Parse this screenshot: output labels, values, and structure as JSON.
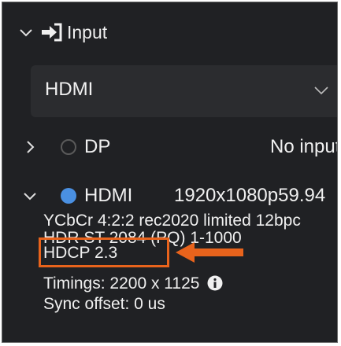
{
  "section": {
    "title": "Input"
  },
  "select": {
    "value": "HDMI"
  },
  "inputs": [
    {
      "name": "DP",
      "status": "No input",
      "expanded": false,
      "active": false
    },
    {
      "name": "HDMI",
      "resolution": "1920x1080p59.94",
      "expanded": true,
      "active": true
    }
  ],
  "hdmi_details": {
    "color": "YCbCr 4:2:2 rec2020 limited 12bpc",
    "hdr": "HDR ST 2084 (PQ) 1-1000",
    "hdcp": "HDCP 2.3",
    "timings": "Timings: 2200 x 1125",
    "sync": "Sync offset: 0 us"
  },
  "colors": {
    "accent": "#4a90e2",
    "highlight": "#e8631c",
    "background": "#202124"
  },
  "icons": {
    "collapse": "chevron-down-icon",
    "expand": "chevron-right-icon",
    "input": "input-arrow-icon",
    "info": "info-icon"
  }
}
